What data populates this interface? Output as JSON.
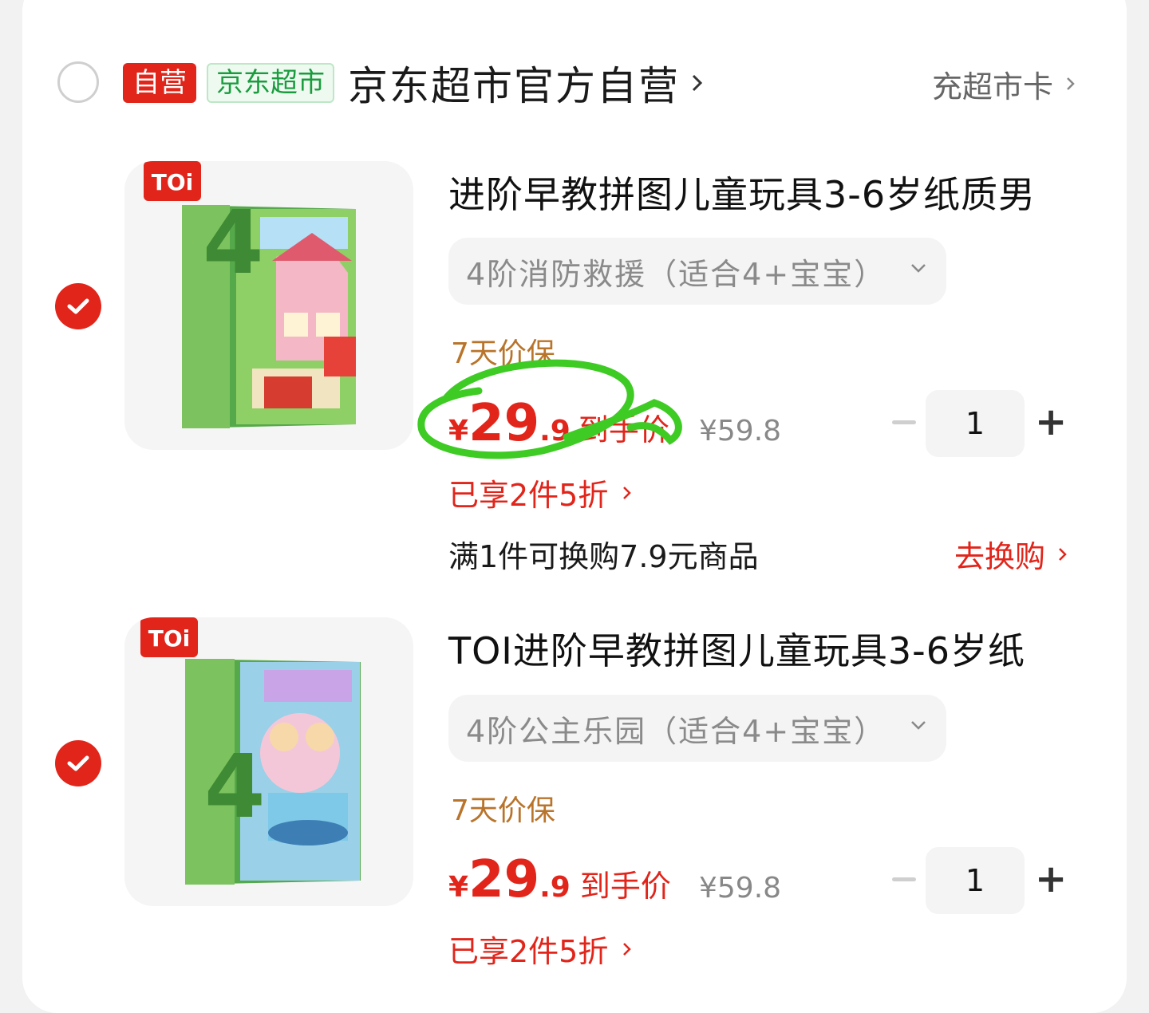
{
  "shop": {
    "badge_self": "自营",
    "badge_market": "京东超市",
    "name": "京东超市官方自营",
    "right_link": "充超市卡"
  },
  "items": [
    {
      "brand_tag": "TOi",
      "title": "进阶早教拼图儿童玩具3-6岁纸质男",
      "spec": "4阶消防救援（适合4+宝宝）",
      "guarantee": "7天价保",
      "price_symbol": "¥",
      "price_int": "29",
      "price_dec": ".9",
      "price_label": "到手价",
      "original_price": "¥59.8",
      "quantity": "1",
      "promo": "已享2件5折",
      "exchange_text": "满1件可换购7.9元商品",
      "exchange_link": "去换购"
    },
    {
      "brand_tag": "TOi",
      "title": "TOI进阶早教拼图儿童玩具3-6岁纸",
      "spec": "4阶公主乐园（适合4+宝宝）",
      "guarantee": "7天价保",
      "price_symbol": "¥",
      "price_int": "29",
      "price_dec": ".9",
      "price_label": "到手价",
      "original_price": "¥59.8",
      "quantity": "1",
      "promo": "已享2件5折"
    }
  ],
  "colors": {
    "accent_red": "#e1251b",
    "market_green": "#1a9c3e",
    "guarantee_brown": "#b8742a",
    "annotation_green": "#3ecb24"
  },
  "icons": [
    "check-icon",
    "chevron-right-icon",
    "chevron-down-icon",
    "minus-icon",
    "plus-icon"
  ]
}
